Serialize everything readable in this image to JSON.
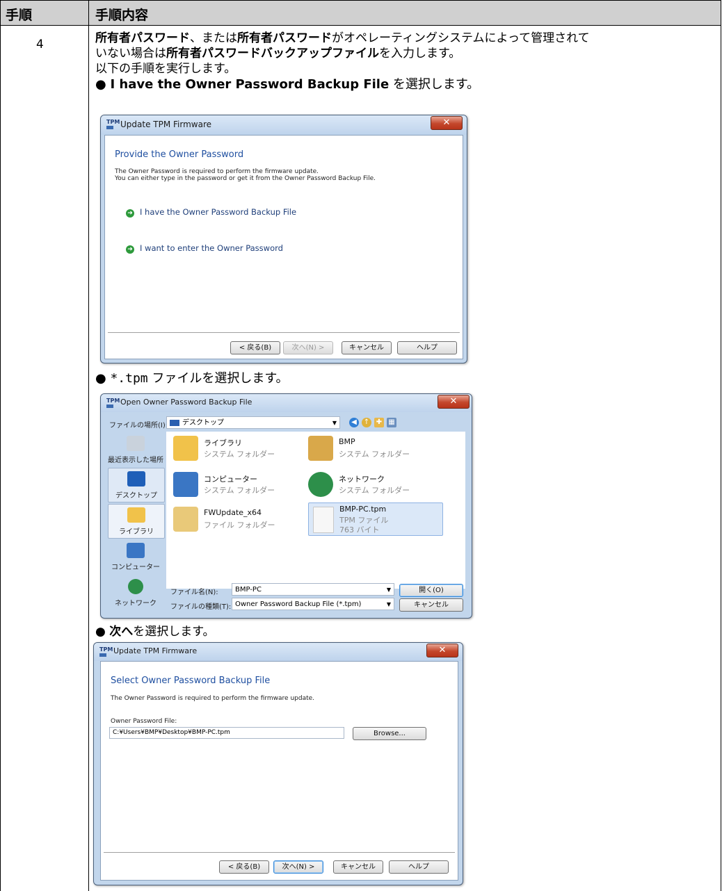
{
  "table": {
    "col_step": "手順",
    "col_content": "手順内容",
    "step": "4"
  },
  "instructions": {
    "line1_b1": "所有者パスワード",
    "line1_t1": "、または",
    "line1_b2": "所有者パスワード",
    "line1_t2": "がオペレーティングシステムによって管理されて",
    "line2_t1": "いない場合は",
    "line2_b1": "所有者パスワードバックアップファイル",
    "line2_t2": "を入力します。",
    "line3": "以下の手順を実行します。",
    "bullet1_b": "I have the Owner Password Backup File",
    "bullet1_t": " を選択します。",
    "bullet2_code": "*.tpm",
    "bullet2_t": " ファイルを選択します。",
    "bullet3_b": "次へ",
    "bullet3_t": "を選択します。"
  },
  "wizard1": {
    "window_title": "Update TPM Firmware",
    "heading": "Provide the Owner Password",
    "desc1": "The Owner Password is required to perform the firmware update.",
    "desc2": "You can either type in the password or get it from the Owner Password Backup File.",
    "option1": "I have the Owner Password Backup File",
    "option2": "I want to enter the Owner Password",
    "buttons": {
      "back": "< 戻る(B)",
      "next": "次へ(N) >",
      "cancel": "キャンセル",
      "help": "ヘルプ"
    }
  },
  "file_dialog": {
    "window_title": "Open Owner Password Backup File",
    "location_label": "ファイルの場所(I):",
    "location_value": "デスクトップ",
    "places": [
      "最近表示した場所",
      "デスクトップ",
      "ライブラリ",
      "コンピューター",
      "ネットワーク"
    ],
    "items": [
      {
        "name": "ライブラリ",
        "sub1": "システム フォルダー",
        "sub2": ""
      },
      {
        "name": "BMP",
        "sub1": "システム フォルダー",
        "sub2": ""
      },
      {
        "name": "コンピューター",
        "sub1": "システム フォルダー",
        "sub2": ""
      },
      {
        "name": "ネットワーク",
        "sub1": "システム フォルダー",
        "sub2": ""
      },
      {
        "name": "FWUpdate_x64",
        "sub1": "ファイル フォルダー",
        "sub2": ""
      },
      {
        "name": "BMP-PC.tpm",
        "sub1": "TPM ファイル",
        "sub2": "763 バイト"
      }
    ],
    "filename_label": "ファイル名(N):",
    "filename_value": "BMP-PC",
    "filetype_label": "ファイルの種類(T):",
    "filetype_value": "Owner Password Backup File (*.tpm)",
    "open_button": "開く(O)",
    "cancel_button": "キャンセル"
  },
  "wizard2": {
    "window_title": "Update TPM Firmware",
    "heading": "Select Owner Password Backup File",
    "desc1": "The Owner Password is required to perform the firmware update.",
    "file_label": "Owner Password File:",
    "file_value": "C:¥Users¥BMP¥Desktop¥BMP-PC.tpm",
    "browse_button": "Browse...",
    "buttons": {
      "back": "< 戻る(B)",
      "next": "次へ(N) >",
      "cancel": "キャンセル",
      "help": "ヘルプ"
    }
  },
  "colors": {
    "header_bg": "#d0d0d0",
    "wizard_heading": "#1f4fa0",
    "close_button": "#c4472c"
  }
}
